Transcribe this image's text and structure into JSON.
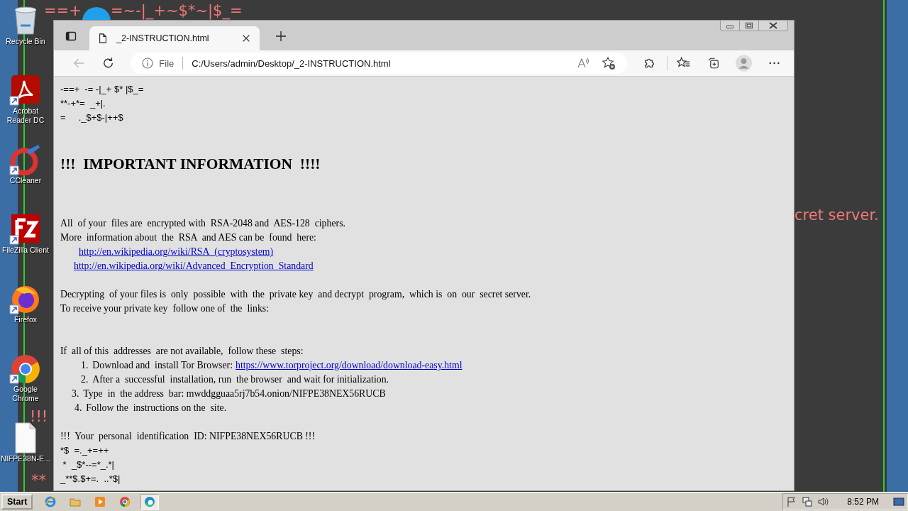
{
  "desktop": {
    "wallpaper_fragments": [
      "==+",
      "=~-|_+~$*~|$_=",
      "!!!",
      "**",
      "cret server."
    ],
    "icons": [
      {
        "kind": "recycle",
        "label": "Recycle Bin"
      },
      {
        "kind": "pdf",
        "label": "Acrobat Reader DC"
      },
      {
        "kind": "ccleaner",
        "label": "CCleaner"
      },
      {
        "kind": "filezilla",
        "label": "FileZilla Client"
      },
      {
        "kind": "firefox",
        "label": "Firefox"
      },
      {
        "kind": "chrome",
        "label": "Google Chrome"
      },
      {
        "kind": "file",
        "label": "NIFPE38N-E..."
      }
    ]
  },
  "browser": {
    "tab": {
      "title": "_2-INSTRUCTION.html",
      "selected": true
    },
    "address": {
      "scheme": "File",
      "url": "C:/Users/admin/Desktop/_2-INSTRUCTION.html"
    }
  },
  "page": {
    "blocks": [
      {
        "kind": "ascii",
        "lines": [
          "-==+  -= -|_+ $* |$_=",
          "**-+*=  _+|.",
          "=     ._$+$-|++$"
        ]
      },
      {
        "kind": "heading",
        "text": "!!!  IMPORTANT INFORMATION  !!!!"
      },
      {
        "kind": "paragraph",
        "lines": [
          {
            "kind": "text",
            "text": "All  of your  files are  encrypted with  RSA-2048 and  AES-128  ciphers."
          },
          {
            "kind": "text",
            "text": "More  information about  the  RSA  and AES can be  found  here:"
          },
          {
            "kind": "link",
            "text": "http://en.wikipedia.org/wiki/RSA_(cryptosystem)"
          },
          {
            "kind": "link2",
            "text": "http://en.wikipedia.org/wiki/Advanced_Encryption_Standard"
          }
        ]
      },
      {
        "kind": "paragraph",
        "lines": [
          {
            "kind": "text",
            "text": "Decrypting  of your files is  only  possible  with  the  private key  and decrypt  program,  which is  on  our  secret server."
          },
          {
            "kind": "text",
            "text": "To receive your private key  follow one of  the  links:"
          }
        ]
      },
      {
        "kind": "steps",
        "intro": "If  all of this  addresses  are not available,  follow these  steps:",
        "items": [
          {
            "number": "1.",
            "text": "Download and  install Tor Browser:",
            "link": "https://www.torproject.org/download/download-easy.html"
          },
          {
            "number": "2.",
            "text": "After a  successful  installation, run  the browser  and wait for initialization."
          },
          {
            "number": "3.",
            "text": "Type  in  the address  bar: mwddgguaa5rj7b54.onion/NIFPE38NEX56RUCB"
          },
          {
            "number": "4.",
            "text": "Follow the  instructions on the  site."
          }
        ]
      },
      {
        "kind": "ascii_tail",
        "lines": [
          "!!!  Your  personal  identification  ID: NIFPE38NEX56RUCB !!!",
          "*$  =._+=++",
          " *  _$*--=*_.*|",
          "_**$.$+=.  ..*$|"
        ]
      }
    ]
  },
  "taskbar": {
    "start": "Start",
    "apps": [
      {
        "kind": "ie",
        "selected": false
      },
      {
        "kind": "folder",
        "selected": false
      },
      {
        "kind": "media",
        "selected": false
      },
      {
        "kind": "chrome",
        "selected": false
      },
      {
        "kind": "edge",
        "selected": true
      }
    ],
    "clock": "8:52 PM"
  }
}
